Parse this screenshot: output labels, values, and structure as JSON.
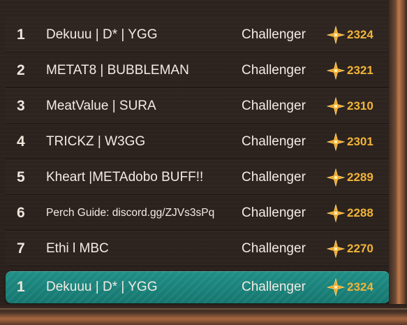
{
  "leaderboard": {
    "rows": [
      {
        "rank": "1",
        "name": "Dekuuu | D* | YGG",
        "tier": "Challenger",
        "lp": "2324"
      },
      {
        "rank": "2",
        "name": "METAT8 | BUBBLEMAN",
        "tier": "Challenger",
        "lp": "2321"
      },
      {
        "rank": "3",
        "name": "MeatValue | SURA",
        "tier": "Challenger",
        "lp": "2310"
      },
      {
        "rank": "4",
        "name": "TRICKZ | W3GG",
        "tier": "Challenger",
        "lp": "2301"
      },
      {
        "rank": "5",
        "name": "Kheart |METAdobo BUFF!!",
        "tier": "Challenger",
        "lp": "2289"
      },
      {
        "rank": "6",
        "name": "Perch Guide: discord.gg/ZJVs3sPq",
        "tier": "Challenger",
        "lp": "2288"
      },
      {
        "rank": "7",
        "name": "Ethi l MBC",
        "tier": "Challenger",
        "lp": "2270"
      }
    ],
    "self": {
      "rank": "1",
      "name": "Dekuuu | D* | YGG",
      "tier": "Challenger",
      "lp": "2324"
    }
  },
  "colors": {
    "accent_gold": "#f2b437",
    "self_row": "#1f8f86",
    "background": "#2a1f1a"
  },
  "icons": {
    "lp": "challenger-star-icon"
  }
}
